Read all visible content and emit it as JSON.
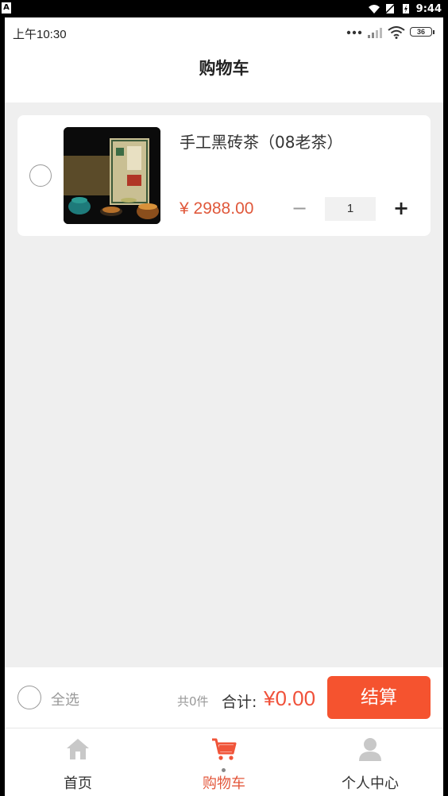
{
  "system_bar": {
    "app_indicator": "A",
    "time": "9:44"
  },
  "status_bar": {
    "time": "上午10:30",
    "battery": "36"
  },
  "header": {
    "title": "购物车"
  },
  "cart": {
    "items": [
      {
        "name": "手工黑砖茶（08老茶）",
        "price": "¥ 2988.00",
        "quantity": "1",
        "minus_label": "−",
        "plus_label": "+"
      }
    ]
  },
  "checkout": {
    "select_all_label": "全选",
    "count_label": "共0件",
    "total_label": "合计:",
    "total_value": "¥0.00",
    "button_label": "结算"
  },
  "tabbar": {
    "items": [
      {
        "label": "首页",
        "icon": "home-icon"
      },
      {
        "label": "购物车",
        "icon": "cart-icon",
        "active": true
      },
      {
        "label": "个人中心",
        "icon": "person-icon"
      }
    ]
  },
  "colors": {
    "accent": "#f5532f",
    "price": "#e0583b",
    "background": "#efefef"
  }
}
